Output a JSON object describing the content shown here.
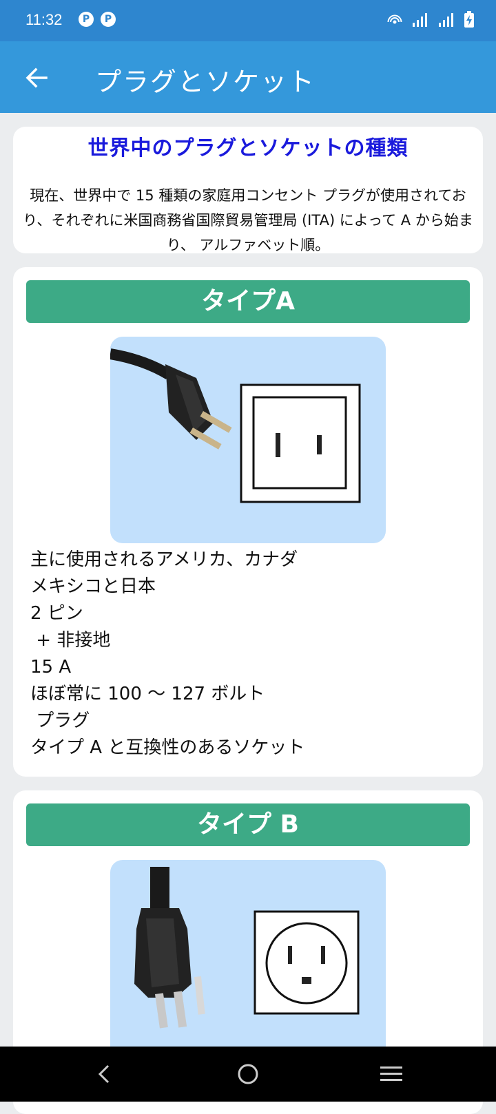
{
  "status_bar": {
    "time": "11:32",
    "left_icons": [
      "app-notification-icon",
      "app-notification-icon"
    ],
    "right_icons": [
      "hotspot-icon",
      "signal-icon",
      "signal-icon",
      "battery-charging-icon"
    ]
  },
  "app_bar": {
    "back_icon": "arrow-back-icon",
    "title": "プラグとソケット"
  },
  "intro": {
    "title": "世界中のプラグとソケットの種類",
    "text": "現在、世界中で 15 種類の家庭用コンセント プラグが使用されており、それぞれに米国商務省国際貿易管理局 (ITA) によって A から始まり、 アルファベット順。"
  },
  "types": [
    {
      "header": "タイプA",
      "details": [
        "主に使用されるアメリカ、カナダ",
        "メキシコと日本",
        "2 ピン",
        " + 非接地",
        "15 A",
        "ほぼ常に 100 〜 127 ボルト",
        " プラグ",
        "タイプ A と互換性のあるソケット"
      ]
    },
    {
      "header": "タイプ B",
      "details": []
    }
  ],
  "nav_bar": {
    "icons": [
      "nav-back-icon",
      "nav-home-icon",
      "nav-recents-icon"
    ]
  },
  "colors": {
    "status_bar": "#2e86cf",
    "app_bar": "#3498db",
    "type_header": "#3daa86",
    "image_bg": "#c2e0fc",
    "intro_title": "#1a1adc"
  }
}
